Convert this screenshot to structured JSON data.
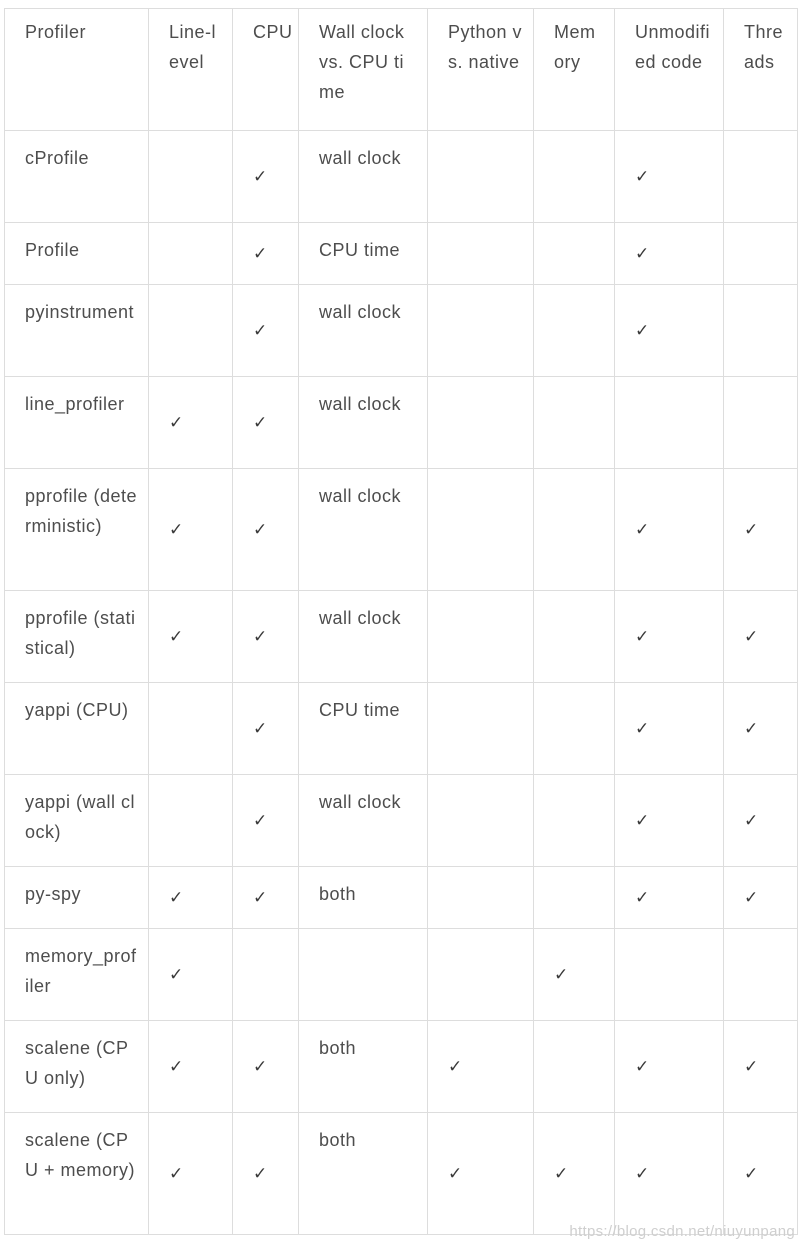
{
  "table": {
    "headers": [
      "Profiler",
      "Line-level",
      "CPU",
      "Wall clock vs. CPU time",
      "Python vs. native",
      "Memory",
      "Unmodified code",
      "Threads"
    ],
    "rows": [
      {
        "profiler": "cProfile",
        "line_level": "",
        "cpu": "✓",
        "wall_cpu": "wall clock",
        "python_native": "",
        "memory": "",
        "unmodified": "✓",
        "threads": ""
      },
      {
        "profiler": "Profile",
        "line_level": "",
        "cpu": "✓",
        "wall_cpu": "CPU time",
        "python_native": "",
        "memory": "",
        "unmodified": "✓",
        "threads": ""
      },
      {
        "profiler": "pyinstrument",
        "line_level": "",
        "cpu": "✓",
        "wall_cpu": "wall clock",
        "python_native": "",
        "memory": "",
        "unmodified": "✓",
        "threads": ""
      },
      {
        "profiler": "line_profiler",
        "line_level": "✓",
        "cpu": "✓",
        "wall_cpu": "wall clock",
        "python_native": "",
        "memory": "",
        "unmodified": "",
        "threads": ""
      },
      {
        "profiler": "pprofile (deterministic)",
        "line_level": "✓",
        "cpu": "✓",
        "wall_cpu": "wall clock",
        "python_native": "",
        "memory": "",
        "unmodified": "✓",
        "threads": "✓"
      },
      {
        "profiler": "pprofile (statistical)",
        "line_level": "✓",
        "cpu": "✓",
        "wall_cpu": "wall clock",
        "python_native": "",
        "memory": "",
        "unmodified": "✓",
        "threads": "✓"
      },
      {
        "profiler": "yappi (CPU)",
        "line_level": "",
        "cpu": "✓",
        "wall_cpu": "CPU time",
        "python_native": "",
        "memory": "",
        "unmodified": "✓",
        "threads": "✓"
      },
      {
        "profiler": "yappi (wall clock)",
        "line_level": "",
        "cpu": "✓",
        "wall_cpu": "wall clock",
        "python_native": "",
        "memory": "",
        "unmodified": "✓",
        "threads": "✓"
      },
      {
        "profiler": "py-spy",
        "line_level": "✓",
        "cpu": "✓",
        "wall_cpu": "both",
        "python_native": "",
        "memory": "",
        "unmodified": "✓",
        "threads": "✓"
      },
      {
        "profiler": "memory_profiler",
        "line_level": "✓",
        "cpu": "",
        "wall_cpu": "",
        "python_native": "",
        "memory": "✓",
        "unmodified": "",
        "threads": ""
      },
      {
        "profiler": "scalene (CPU only)",
        "line_level": "✓",
        "cpu": "✓",
        "wall_cpu": "both",
        "python_native": "✓",
        "memory": "",
        "unmodified": "✓",
        "threads": "✓"
      },
      {
        "profiler": "scalene (CPU + memory)",
        "line_level": "✓",
        "cpu": "✓",
        "wall_cpu": "both",
        "python_native": "✓",
        "memory": "✓",
        "unmodified": "✓",
        "threads": "✓"
      }
    ]
  },
  "watermark": "https://blog.csdn.net/niuyunpang"
}
